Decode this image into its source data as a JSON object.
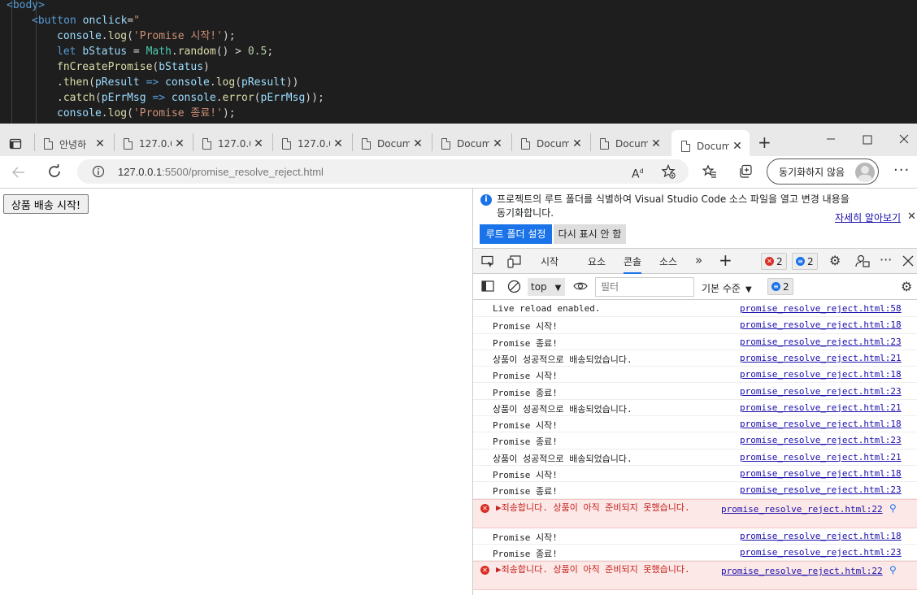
{
  "code": {
    "lines": [
      {
        "indent": 0,
        "parts": [
          {
            "c": "tag",
            "t": "<body>"
          }
        ]
      },
      {
        "indent": 1,
        "parts": [
          {
            "c": "tag",
            "t": "<button"
          },
          {
            "c": "pl",
            "t": " "
          },
          {
            "c": "attr",
            "t": "onclick"
          },
          {
            "c": "pl",
            "t": "="
          },
          {
            "c": "str",
            "t": "\""
          }
        ]
      },
      {
        "indent": 2,
        "parts": [
          {
            "c": "var",
            "t": "console"
          },
          {
            "c": "pl",
            "t": "."
          },
          {
            "c": "fn",
            "t": "log"
          },
          {
            "c": "pl",
            "t": "("
          },
          {
            "c": "str",
            "t": "'Promise 시작!'"
          },
          {
            "c": "pl",
            "t": ");"
          }
        ]
      },
      {
        "indent": 2,
        "parts": [
          {
            "c": "kw",
            "t": "let"
          },
          {
            "c": "pl",
            "t": " "
          },
          {
            "c": "var",
            "t": "bStatus"
          },
          {
            "c": "pl",
            "t": " = "
          },
          {
            "c": "cls",
            "t": "Math"
          },
          {
            "c": "pl",
            "t": "."
          },
          {
            "c": "fn",
            "t": "random"
          },
          {
            "c": "pl",
            "t": "() > "
          },
          {
            "c": "num",
            "t": "0.5"
          },
          {
            "c": "pl",
            "t": ";"
          }
        ]
      },
      {
        "indent": 2,
        "parts": [
          {
            "c": "fn",
            "t": "fnCreatePromise"
          },
          {
            "c": "pl",
            "t": "("
          },
          {
            "c": "var",
            "t": "bStatus"
          },
          {
            "c": "pl",
            "t": ")"
          }
        ]
      },
      {
        "indent": 2,
        "parts": [
          {
            "c": "pl",
            "t": "."
          },
          {
            "c": "fn",
            "t": "then"
          },
          {
            "c": "pl",
            "t": "("
          },
          {
            "c": "var",
            "t": "pResult"
          },
          {
            "c": "pl",
            "t": " "
          },
          {
            "c": "kw",
            "t": "=>"
          },
          {
            "c": "pl",
            "t": " "
          },
          {
            "c": "var",
            "t": "console"
          },
          {
            "c": "pl",
            "t": "."
          },
          {
            "c": "fn",
            "t": "log"
          },
          {
            "c": "pl",
            "t": "("
          },
          {
            "c": "var",
            "t": "pResult"
          },
          {
            "c": "pl",
            "t": "))"
          }
        ]
      },
      {
        "indent": 2,
        "parts": [
          {
            "c": "pl",
            "t": "."
          },
          {
            "c": "fn",
            "t": "catch"
          },
          {
            "c": "pl",
            "t": "("
          },
          {
            "c": "var",
            "t": "pErrMsg"
          },
          {
            "c": "pl",
            "t": " "
          },
          {
            "c": "kw",
            "t": "=>"
          },
          {
            "c": "pl",
            "t": " "
          },
          {
            "c": "var",
            "t": "console"
          },
          {
            "c": "pl",
            "t": "."
          },
          {
            "c": "fn",
            "t": "error"
          },
          {
            "c": "pl",
            "t": "("
          },
          {
            "c": "var",
            "t": "pErrMsg"
          },
          {
            "c": "pl",
            "t": "));"
          }
        ]
      },
      {
        "indent": 2,
        "parts": [
          {
            "c": "var",
            "t": "console"
          },
          {
            "c": "pl",
            "t": "."
          },
          {
            "c": "fn",
            "t": "log"
          },
          {
            "c": "pl",
            "t": "("
          },
          {
            "c": "str",
            "t": "'Promise 종료!'"
          },
          {
            "c": "pl",
            "t": ");"
          }
        ]
      }
    ]
  },
  "tabs": [
    {
      "title": "안녕하",
      "active": false
    },
    {
      "title": "127.0.0",
      "active": false
    },
    {
      "title": "127.0.0",
      "active": false
    },
    {
      "title": "127.0.0",
      "active": false
    },
    {
      "title": "Docum",
      "active": false
    },
    {
      "title": "Docum",
      "active": false
    },
    {
      "title": "Docum",
      "active": false
    },
    {
      "title": "Docum",
      "active": false
    },
    {
      "title": "Docum",
      "active": true
    }
  ],
  "address": {
    "host": "127.0.0.1",
    "path": ":5500/promise_resolve_reject.html",
    "sync_label": "동기화하지 않음"
  },
  "page": {
    "button_label": "상품 배송 시작!"
  },
  "devtools": {
    "info_text": "프로젝트의 루트 폴더를 식별하여 Visual Studio Code 소스 파일을 열고 변경 내용을 동기화합니다.",
    "learn_more": "자세히 알아보기",
    "set_root_label": "루트 폴더 설정",
    "dont_show_label": "다시 표시 안 함",
    "tabs": [
      "시작",
      "요소",
      "콘솔",
      "소스"
    ],
    "selected_tab": "콘솔",
    "error_count": "2",
    "message_count": "2",
    "context": "top",
    "filter_placeholder": "필터",
    "level_label": "기본 수준",
    "level_count": "2"
  },
  "console": [
    {
      "type": "log",
      "msg": "Live reload enabled.",
      "src": "promise_resolve_reject.html:58"
    },
    {
      "type": "log",
      "msg": "Promise 시작!",
      "src": "promise_resolve_reject.html:18"
    },
    {
      "type": "log",
      "msg": "Promise 종료!",
      "src": "promise_resolve_reject.html:23"
    },
    {
      "type": "log",
      "msg": "상품이 성공적으로 배송되었습니다.",
      "src": "promise_resolve_reject.html:21"
    },
    {
      "type": "log",
      "msg": "Promise 시작!",
      "src": "promise_resolve_reject.html:18"
    },
    {
      "type": "log",
      "msg": "Promise 종료!",
      "src": "promise_resolve_reject.html:23"
    },
    {
      "type": "log",
      "msg": "상품이 성공적으로 배송되었습니다.",
      "src": "promise_resolve_reject.html:21"
    },
    {
      "type": "log",
      "msg": "Promise 시작!",
      "src": "promise_resolve_reject.html:18"
    },
    {
      "type": "log",
      "msg": "Promise 종료!",
      "src": "promise_resolve_reject.html:23"
    },
    {
      "type": "log",
      "msg": "상품이 성공적으로 배송되었습니다.",
      "src": "promise_resolve_reject.html:21"
    },
    {
      "type": "log",
      "msg": "Promise 시작!",
      "src": "promise_resolve_reject.html:18"
    },
    {
      "type": "log",
      "msg": "Promise 종료!",
      "src": "promise_resolve_reject.html:23"
    },
    {
      "type": "error",
      "msg": "▶죄송합니다. 상품이 아직 준비되지 못했습니다.",
      "src": "promise_resolve_reject.html:22"
    },
    {
      "type": "log",
      "msg": "Promise 시작!",
      "src": "promise_resolve_reject.html:18"
    },
    {
      "type": "log",
      "msg": "Promise 종료!",
      "src": "promise_resolve_reject.html:23"
    },
    {
      "type": "error",
      "msg": "▶죄송합니다. 상품이 아직 준비되지 못했습니다.",
      "src": "promise_resolve_reject.html:22"
    }
  ]
}
